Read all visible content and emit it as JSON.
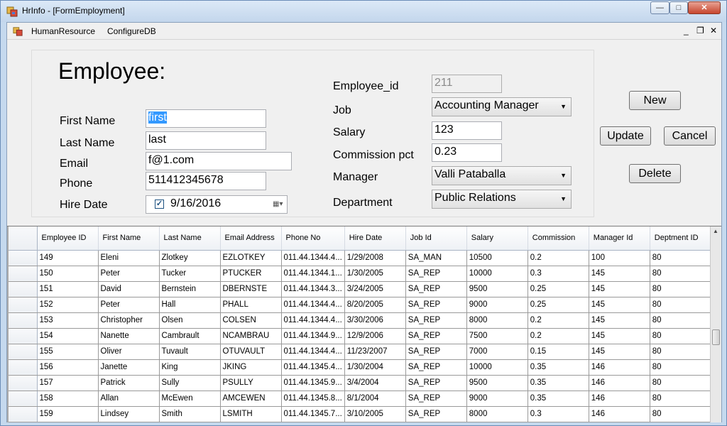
{
  "window": {
    "title": "HrInfo - [FormEmployment]",
    "minimize": "—",
    "maximize": "□",
    "close": "✕"
  },
  "menu": {
    "items": [
      "HumanResource",
      "ConfigureDB"
    ],
    "mdi": {
      "minimize": "_",
      "restore": "❐",
      "close": "✕"
    }
  },
  "form": {
    "heading": "Employee:",
    "labels": {
      "first_name": "First Name",
      "last_name": "Last Name",
      "email": "Email",
      "phone": "Phone",
      "hire_date": "Hire Date",
      "employee_id": "Employee_id",
      "job": "Job",
      "salary": "Salary",
      "commission": "Commission pct",
      "manager": "Manager",
      "department": "Department"
    },
    "values": {
      "first_name": "first",
      "last_name": "last",
      "email": "f@1.com",
      "phone": "511412345678",
      "hire_date": "9/16/2016",
      "hire_date_checked": "✓",
      "employee_id": "211",
      "job": "Accounting Manager",
      "salary": "123",
      "commission": "0.23",
      "manager": "Valli Pataballa",
      "department": "Public Relations"
    },
    "buttons": {
      "new": "New",
      "update": "Update",
      "cancel": "Cancel",
      "delete": "Delete"
    }
  },
  "grid": {
    "columns": [
      "Employee ID",
      "First Name",
      "Last Name",
      "Email Address",
      "Phone No",
      "Hire Date",
      "Job Id",
      "Salary",
      "Commission",
      "Manager Id",
      "Deptment ID"
    ],
    "rows": [
      [
        "149",
        "Eleni",
        "Zlotkey",
        "EZLOTKEY",
        "011.44.1344.4...",
        "1/29/2008",
        "SA_MAN",
        "10500",
        "0.2",
        "100",
        "80"
      ],
      [
        "150",
        "Peter",
        "Tucker",
        "PTUCKER",
        "011.44.1344.1...",
        "1/30/2005",
        "SA_REP",
        "10000",
        "0.3",
        "145",
        "80"
      ],
      [
        "151",
        "David",
        "Bernstein",
        "DBERNSTE",
        "011.44.1344.3...",
        "3/24/2005",
        "SA_REP",
        "9500",
        "0.25",
        "145",
        "80"
      ],
      [
        "152",
        "Peter",
        "Hall",
        "PHALL",
        "011.44.1344.4...",
        "8/20/2005",
        "SA_REP",
        "9000",
        "0.25",
        "145",
        "80"
      ],
      [
        "153",
        "Christopher",
        "Olsen",
        "COLSEN",
        "011.44.1344.4...",
        "3/30/2006",
        "SA_REP",
        "8000",
        "0.2",
        "145",
        "80"
      ],
      [
        "154",
        "Nanette",
        "Cambrault",
        "NCAMBRAU",
        "011.44.1344.9...",
        "12/9/2006",
        "SA_REP",
        "7500",
        "0.2",
        "145",
        "80"
      ],
      [
        "155",
        "Oliver",
        "Tuvault",
        "OTUVAULT",
        "011.44.1344.4...",
        "11/23/2007",
        "SA_REP",
        "7000",
        "0.15",
        "145",
        "80"
      ],
      [
        "156",
        "Janette",
        "King",
        "JKING",
        "011.44.1345.4...",
        "1/30/2004",
        "SA_REP",
        "10000",
        "0.35",
        "146",
        "80"
      ],
      [
        "157",
        "Patrick",
        "Sully",
        "PSULLY",
        "011.44.1345.9...",
        "3/4/2004",
        "SA_REP",
        "9500",
        "0.35",
        "146",
        "80"
      ],
      [
        "158",
        "Allan",
        "McEwen",
        "AMCEWEN",
        "011.44.1345.8...",
        "8/1/2004",
        "SA_REP",
        "9000",
        "0.35",
        "146",
        "80"
      ],
      [
        "159",
        "Lindsey",
        "Smith",
        "LSMITH",
        "011.44.1345.7...",
        "3/10/2005",
        "SA_REP",
        "8000",
        "0.3",
        "146",
        "80"
      ]
    ]
  }
}
